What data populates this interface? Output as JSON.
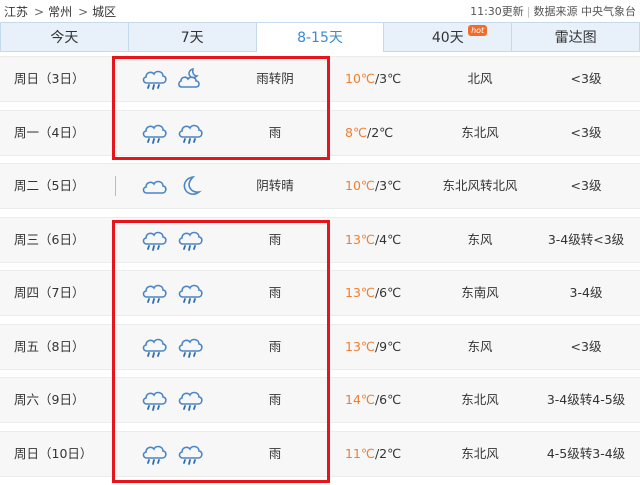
{
  "breadcrumb": [
    "江苏",
    "常州",
    "城区"
  ],
  "breadcrumb_sep": ">",
  "update_time": "11:30更新",
  "source_label": "数据来源 中央气象台",
  "tabs": [
    {
      "label": "今天",
      "active": false
    },
    {
      "label": "7天",
      "active": false
    },
    {
      "label": "8-15天",
      "active": true
    },
    {
      "label": "40天",
      "active": false,
      "badge": "hot"
    },
    {
      "label": "雷达图",
      "active": false
    }
  ],
  "colors": {
    "accent": "#3a8ad6",
    "high_temp": "#f07f2f",
    "highlight_box": "#e8141c"
  },
  "rows": [
    {
      "date": "周日（3日）",
      "icons": [
        "rain-cloud-icon",
        "partly-cloudy-night-icon"
      ],
      "desc": "雨转阴",
      "high": "10℃",
      "low": "3℃",
      "wind": "北风",
      "level": "<3级"
    },
    {
      "date": "周一（4日）",
      "icons": [
        "rain-cloud-icon",
        "rain-cloud-icon"
      ],
      "desc": "雨",
      "high": "8℃",
      "low": "2℃",
      "wind": "东北风",
      "level": "<3级"
    },
    {
      "date": "周二（5日）",
      "icons": [
        "cloud-icon",
        "moon-icon"
      ],
      "desc": "阴转晴",
      "high": "10℃",
      "low": "3℃",
      "wind": "东北风转北风",
      "level": "<3级"
    },
    {
      "date": "周三（6日）",
      "icons": [
        "rain-cloud-icon",
        "rain-cloud-icon"
      ],
      "desc": "雨",
      "high": "13℃",
      "low": "4℃",
      "wind": "东风",
      "level": "3-4级转<3级"
    },
    {
      "date": "周四（7日）",
      "icons": [
        "rain-cloud-icon",
        "rain-cloud-icon"
      ],
      "desc": "雨",
      "high": "13℃",
      "low": "6℃",
      "wind": "东南风",
      "level": "3-4级"
    },
    {
      "date": "周五（8日）",
      "icons": [
        "rain-cloud-icon",
        "rain-cloud-icon"
      ],
      "desc": "雨",
      "high": "13℃",
      "low": "9℃",
      "wind": "东风",
      "level": "<3级"
    },
    {
      "date": "周六（9日）",
      "icons": [
        "rain-cloud-icon",
        "rain-cloud-icon"
      ],
      "desc": "雨",
      "high": "14℃",
      "low": "6℃",
      "wind": "东北风",
      "level": "3-4级转4-5级"
    },
    {
      "date": "周日（10日）",
      "icons": [
        "rain-cloud-icon",
        "rain-cloud-icon"
      ],
      "desc": "雨",
      "high": "11℃",
      "low": "2℃",
      "wind": "东北风",
      "level": "4-5级转3-4级"
    }
  ]
}
